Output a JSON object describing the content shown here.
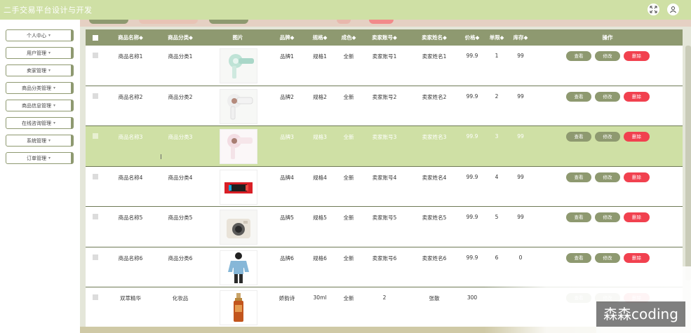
{
  "app": {
    "title": "二手交易平台设计与开发"
  },
  "header": {
    "icons": [
      "expand-icon",
      "user-icon"
    ]
  },
  "sidebar": {
    "items": [
      {
        "label": "个人中心"
      },
      {
        "label": "用户管理"
      },
      {
        "label": "卖家管理"
      },
      {
        "label": "商品分类管理"
      },
      {
        "label": "商品信息管理"
      },
      {
        "label": "在线咨询管理"
      },
      {
        "label": "系统管理"
      },
      {
        "label": "订单管理"
      }
    ]
  },
  "table": {
    "headers": {
      "name": "商品名称",
      "category": "商品分类",
      "image": "图片",
      "brand": "品牌",
      "spec": "规格",
      "condition": "成色",
      "seller_account": "卖家账号",
      "seller_name": "卖家姓名",
      "price": "价格",
      "clicks": "单限",
      "stock": "库存",
      "actions": "操作"
    },
    "rows": [
      {
        "name": "商品名称1",
        "category": "商品分类1",
        "brand": "品牌1",
        "spec": "规格1",
        "condition": "全新",
        "seller_account": "卖家账号1",
        "seller_name": "卖家姓名1",
        "price": "99.9",
        "clicks": "1",
        "stock": "99",
        "image": "hair-dryer-mint"
      },
      {
        "name": "商品名称2",
        "category": "商品分类2",
        "brand": "品牌2",
        "spec": "规格2",
        "condition": "全新",
        "seller_account": "卖家账号2",
        "seller_name": "卖家姓名2",
        "price": "99.9",
        "clicks": "2",
        "stock": "99",
        "image": "hair-dryer-white"
      },
      {
        "name": "商品名称3",
        "category": "商品分类3",
        "brand": "品牌3",
        "spec": "规格3",
        "condition": "全新",
        "seller_account": "卖家账号3",
        "seller_name": "卖家姓名3",
        "price": "99.9",
        "clicks": "3",
        "stock": "99",
        "image": "hair-dryer-pink"
      },
      {
        "name": "商品名称4",
        "category": "商品分类4",
        "brand": "品牌4",
        "spec": "规格4",
        "condition": "全新",
        "seller_account": "卖家账号4",
        "seller_name": "卖家姓名4",
        "price": "99.9",
        "clicks": "4",
        "stock": "99",
        "image": "game-console-box"
      },
      {
        "name": "商品名称5",
        "category": "商品分类5",
        "brand": "品牌5",
        "spec": "规格5",
        "condition": "全新",
        "seller_account": "卖家账号5",
        "seller_name": "卖家姓名5",
        "price": "99.9",
        "clicks": "5",
        "stock": "99",
        "image": "instant-camera"
      },
      {
        "name": "商品名称6",
        "category": "商品分类6",
        "brand": "品牌6",
        "spec": "规格6",
        "condition": "全新",
        "seller_account": "卖家账号6",
        "seller_name": "卖家姓名6",
        "price": "99.9",
        "clicks": "6",
        "stock": "0",
        "image": "person-sweater"
      },
      {
        "name": "双萃精华",
        "category": "化妆品",
        "brand": "娇韵诗",
        "spec": "30ml",
        "condition": "全新",
        "seller_account": "2",
        "seller_name": "张散",
        "price": "300",
        "clicks": "",
        "stock": "",
        "image": "serum-bottle"
      }
    ],
    "actions": {
      "view": "查看",
      "edit": "修改",
      "delete": "删除"
    }
  },
  "watermark": {
    "text": "森森coding"
  },
  "colors": {
    "accent": "#8e9970",
    "topbar": "#cfe0a5",
    "delete": "#f1414f",
    "selected_row": "#cfe0a5"
  }
}
